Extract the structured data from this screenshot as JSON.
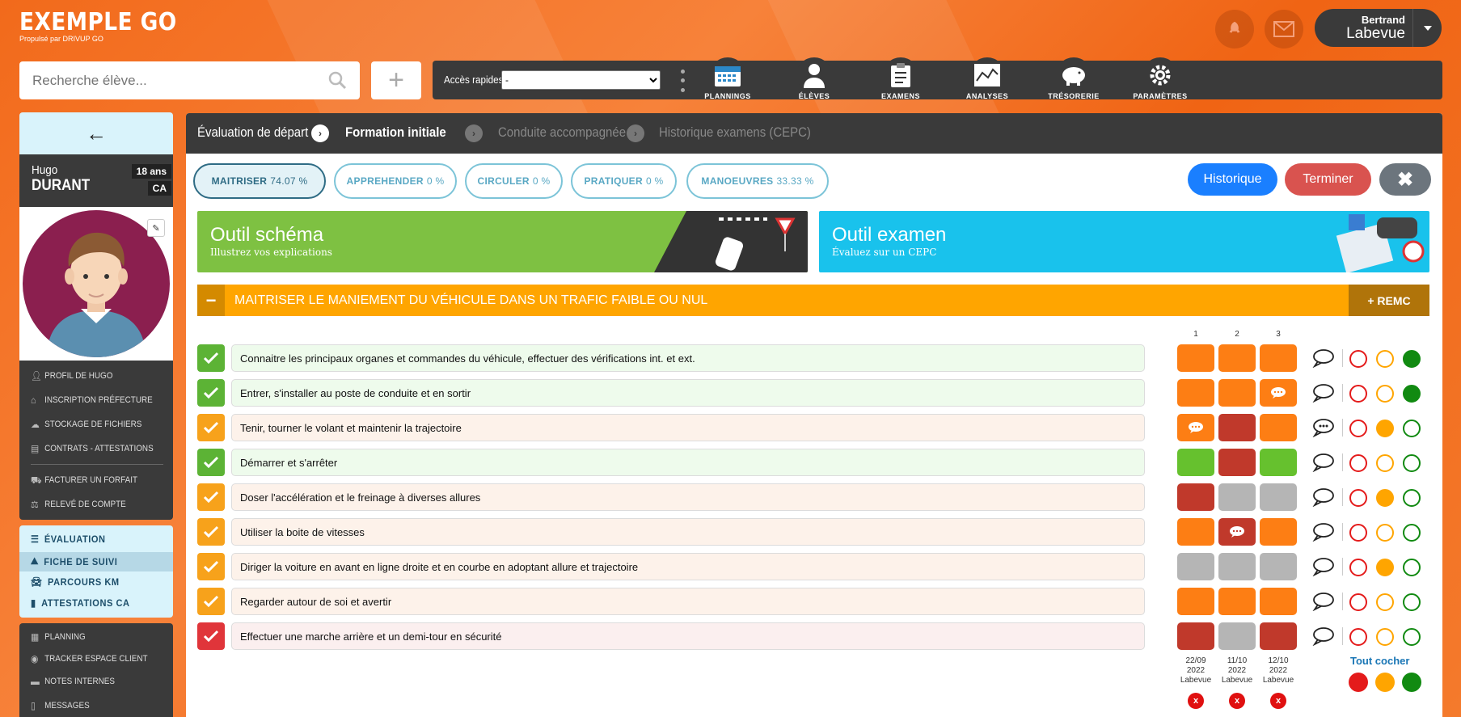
{
  "brand": {
    "title": "EXEMPLE GO",
    "subtitle": "Propulsé par DRIVUP GO"
  },
  "header_icons": [
    "rocket-icon",
    "mail-icon"
  ],
  "user": {
    "first": "Bertrand",
    "last": "Labevue"
  },
  "search": {
    "placeholder": "Recherche élève..."
  },
  "quick": {
    "label": "Accès rapides",
    "selected": "-"
  },
  "nav": [
    {
      "label": "PLANNINGS",
      "icon": "calendar-icon"
    },
    {
      "label": "ÉLÈVES",
      "icon": "user-icon"
    },
    {
      "label": "EXAMENS",
      "icon": "clipboard-icon"
    },
    {
      "label": "ANALYSES",
      "icon": "chart-icon"
    },
    {
      "label": "TRÉSORERIE",
      "icon": "piggy-bank-icon"
    },
    {
      "label": "PARAMÈTRES",
      "icon": "gear-icon"
    }
  ],
  "student": {
    "first": "Hugo",
    "last": "DURANT",
    "age": "18 ans",
    "tag": "CA"
  },
  "side_menu1": [
    {
      "label": "PROFIL DE HUGO",
      "icon": "user-icon"
    },
    {
      "label": "INSCRIPTION PRÉFECTURE",
      "icon": "bank-icon"
    },
    {
      "label": "STOCKAGE DE FICHIERS",
      "icon": "cloud-icon"
    },
    {
      "label": "CONTRATS - ATTESTATIONS",
      "icon": "file-icon"
    },
    {
      "label": "FACTURER UN FORFAIT",
      "icon": "cart-icon"
    },
    {
      "label": "RELEVÉ DE COMPTE",
      "icon": "scale-icon"
    }
  ],
  "side_menu2": [
    {
      "label": "ÉVALUATION",
      "icon": "list-icon"
    },
    {
      "label": "FICHE DE SUIVI",
      "icon": "road-icon"
    },
    {
      "label": "PARCOURS KM",
      "icon": "car-icon"
    },
    {
      "label": "ATTESTATIONS CA",
      "icon": "doc-icon"
    }
  ],
  "side_menu3": [
    {
      "label": "PLANNING",
      "icon": "calendar-icon"
    },
    {
      "label": "TRACKER ESPACE CLIENT",
      "icon": "eye-icon"
    },
    {
      "label": "NOTES INTERNES",
      "icon": "comment-icon"
    },
    {
      "label": "MESSAGES",
      "icon": "phone-icon"
    }
  ],
  "steps": [
    {
      "label": "Évaluation de départ"
    },
    {
      "label": "Formation initiale"
    },
    {
      "label": "Conduite accompagnée"
    },
    {
      "label": "Historique examens (CEPC)"
    }
  ],
  "pills": [
    {
      "name": "MAITRISER",
      "pct": "74.07 %"
    },
    {
      "name": "APPREHENDER",
      "pct": "0 %"
    },
    {
      "name": "CIRCULER",
      "pct": "0 %"
    },
    {
      "name": "PRATIQUER",
      "pct": "0 %"
    },
    {
      "name": "MANOEUVRES",
      "pct": "33.33 %"
    }
  ],
  "buttons": {
    "historique": "Historique",
    "terminer": "Terminer"
  },
  "banners": {
    "schema": {
      "title": "Outil schéma",
      "sub": "Illustrez vos explications"
    },
    "examen": {
      "title": "Outil examen",
      "sub": "Évaluez sur un CEPC"
    }
  },
  "section": {
    "title": "MAITRISER LE MANIEMENT DU VÉHICULE DANS UN TRAFIC FAIBLE OU NUL",
    "remc": "+ REMC",
    "minus": "−"
  },
  "columns": [
    "1",
    "2",
    "3"
  ],
  "colors": {
    "orange": "#fd7e14",
    "red": "#c0392b",
    "green": "#66c12e",
    "grey": "#b5b5b5",
    "accent": "#f26a1b"
  },
  "rows": [
    {
      "label": "Connaitre les principaux organes et commandes du véhicule, effectuer des vérifications int. et ext.",
      "status": "green",
      "cells": [
        "orange",
        "orange",
        "orange"
      ],
      "comments": [
        false,
        false,
        false
      ],
      "level": "green",
      "has_comment": false
    },
    {
      "label": "Entrer, s'installer au poste de conduite et en sortir",
      "status": "green",
      "cells": [
        "orange",
        "orange",
        "orange"
      ],
      "comments": [
        false,
        false,
        true
      ],
      "level": "green",
      "has_comment": false
    },
    {
      "label": "Tenir, tourner le volant et maintenir la trajectoire",
      "status": "orange",
      "cells": [
        "orange",
        "red",
        "orange"
      ],
      "comments": [
        true,
        false,
        false
      ],
      "level": "orange",
      "has_comment": true
    },
    {
      "label": "Démarrer et s'arrêter",
      "status": "green",
      "cells": [
        "green",
        "red",
        "green"
      ],
      "comments": [
        false,
        false,
        false
      ],
      "level": "none",
      "has_comment": false
    },
    {
      "label": "Doser l'accélération et le freinage à diverses allures",
      "status": "orange",
      "cells": [
        "red",
        "grey",
        "grey"
      ],
      "comments": [
        false,
        false,
        false
      ],
      "level": "orange",
      "has_comment": false
    },
    {
      "label": "Utiliser la boite de vitesses",
      "status": "orange",
      "cells": [
        "orange",
        "red",
        "orange"
      ],
      "comments": [
        false,
        true,
        false
      ],
      "level": "none",
      "has_comment": false
    },
    {
      "label": "Diriger la voiture en avant en ligne droite et en courbe en adoptant allure et trajectoire",
      "status": "orange",
      "cells": [
        "grey",
        "grey",
        "grey"
      ],
      "comments": [
        false,
        false,
        false
      ],
      "level": "orange",
      "has_comment": false
    },
    {
      "label": "Regarder autour de soi et avertir",
      "status": "orange",
      "cells": [
        "orange",
        "orange",
        "orange"
      ],
      "comments": [
        false,
        false,
        false
      ],
      "level": "none",
      "has_comment": false
    },
    {
      "label": "Effectuer une marche arrière et un demi-tour en sécurité",
      "status": "red",
      "cells": [
        "red",
        "grey",
        "red"
      ],
      "comments": [
        false,
        false,
        false
      ],
      "level": "none",
      "has_comment": false
    }
  ],
  "dates": [
    {
      "date": "22/09",
      "year": "2022",
      "name": "Labevue"
    },
    {
      "date": "11/10",
      "year": "2022",
      "name": "Labevue"
    },
    {
      "date": "12/10",
      "year": "2022",
      "name": "Labevue"
    }
  ],
  "delete_label": "x",
  "tout_cocher": "Tout cocher"
}
